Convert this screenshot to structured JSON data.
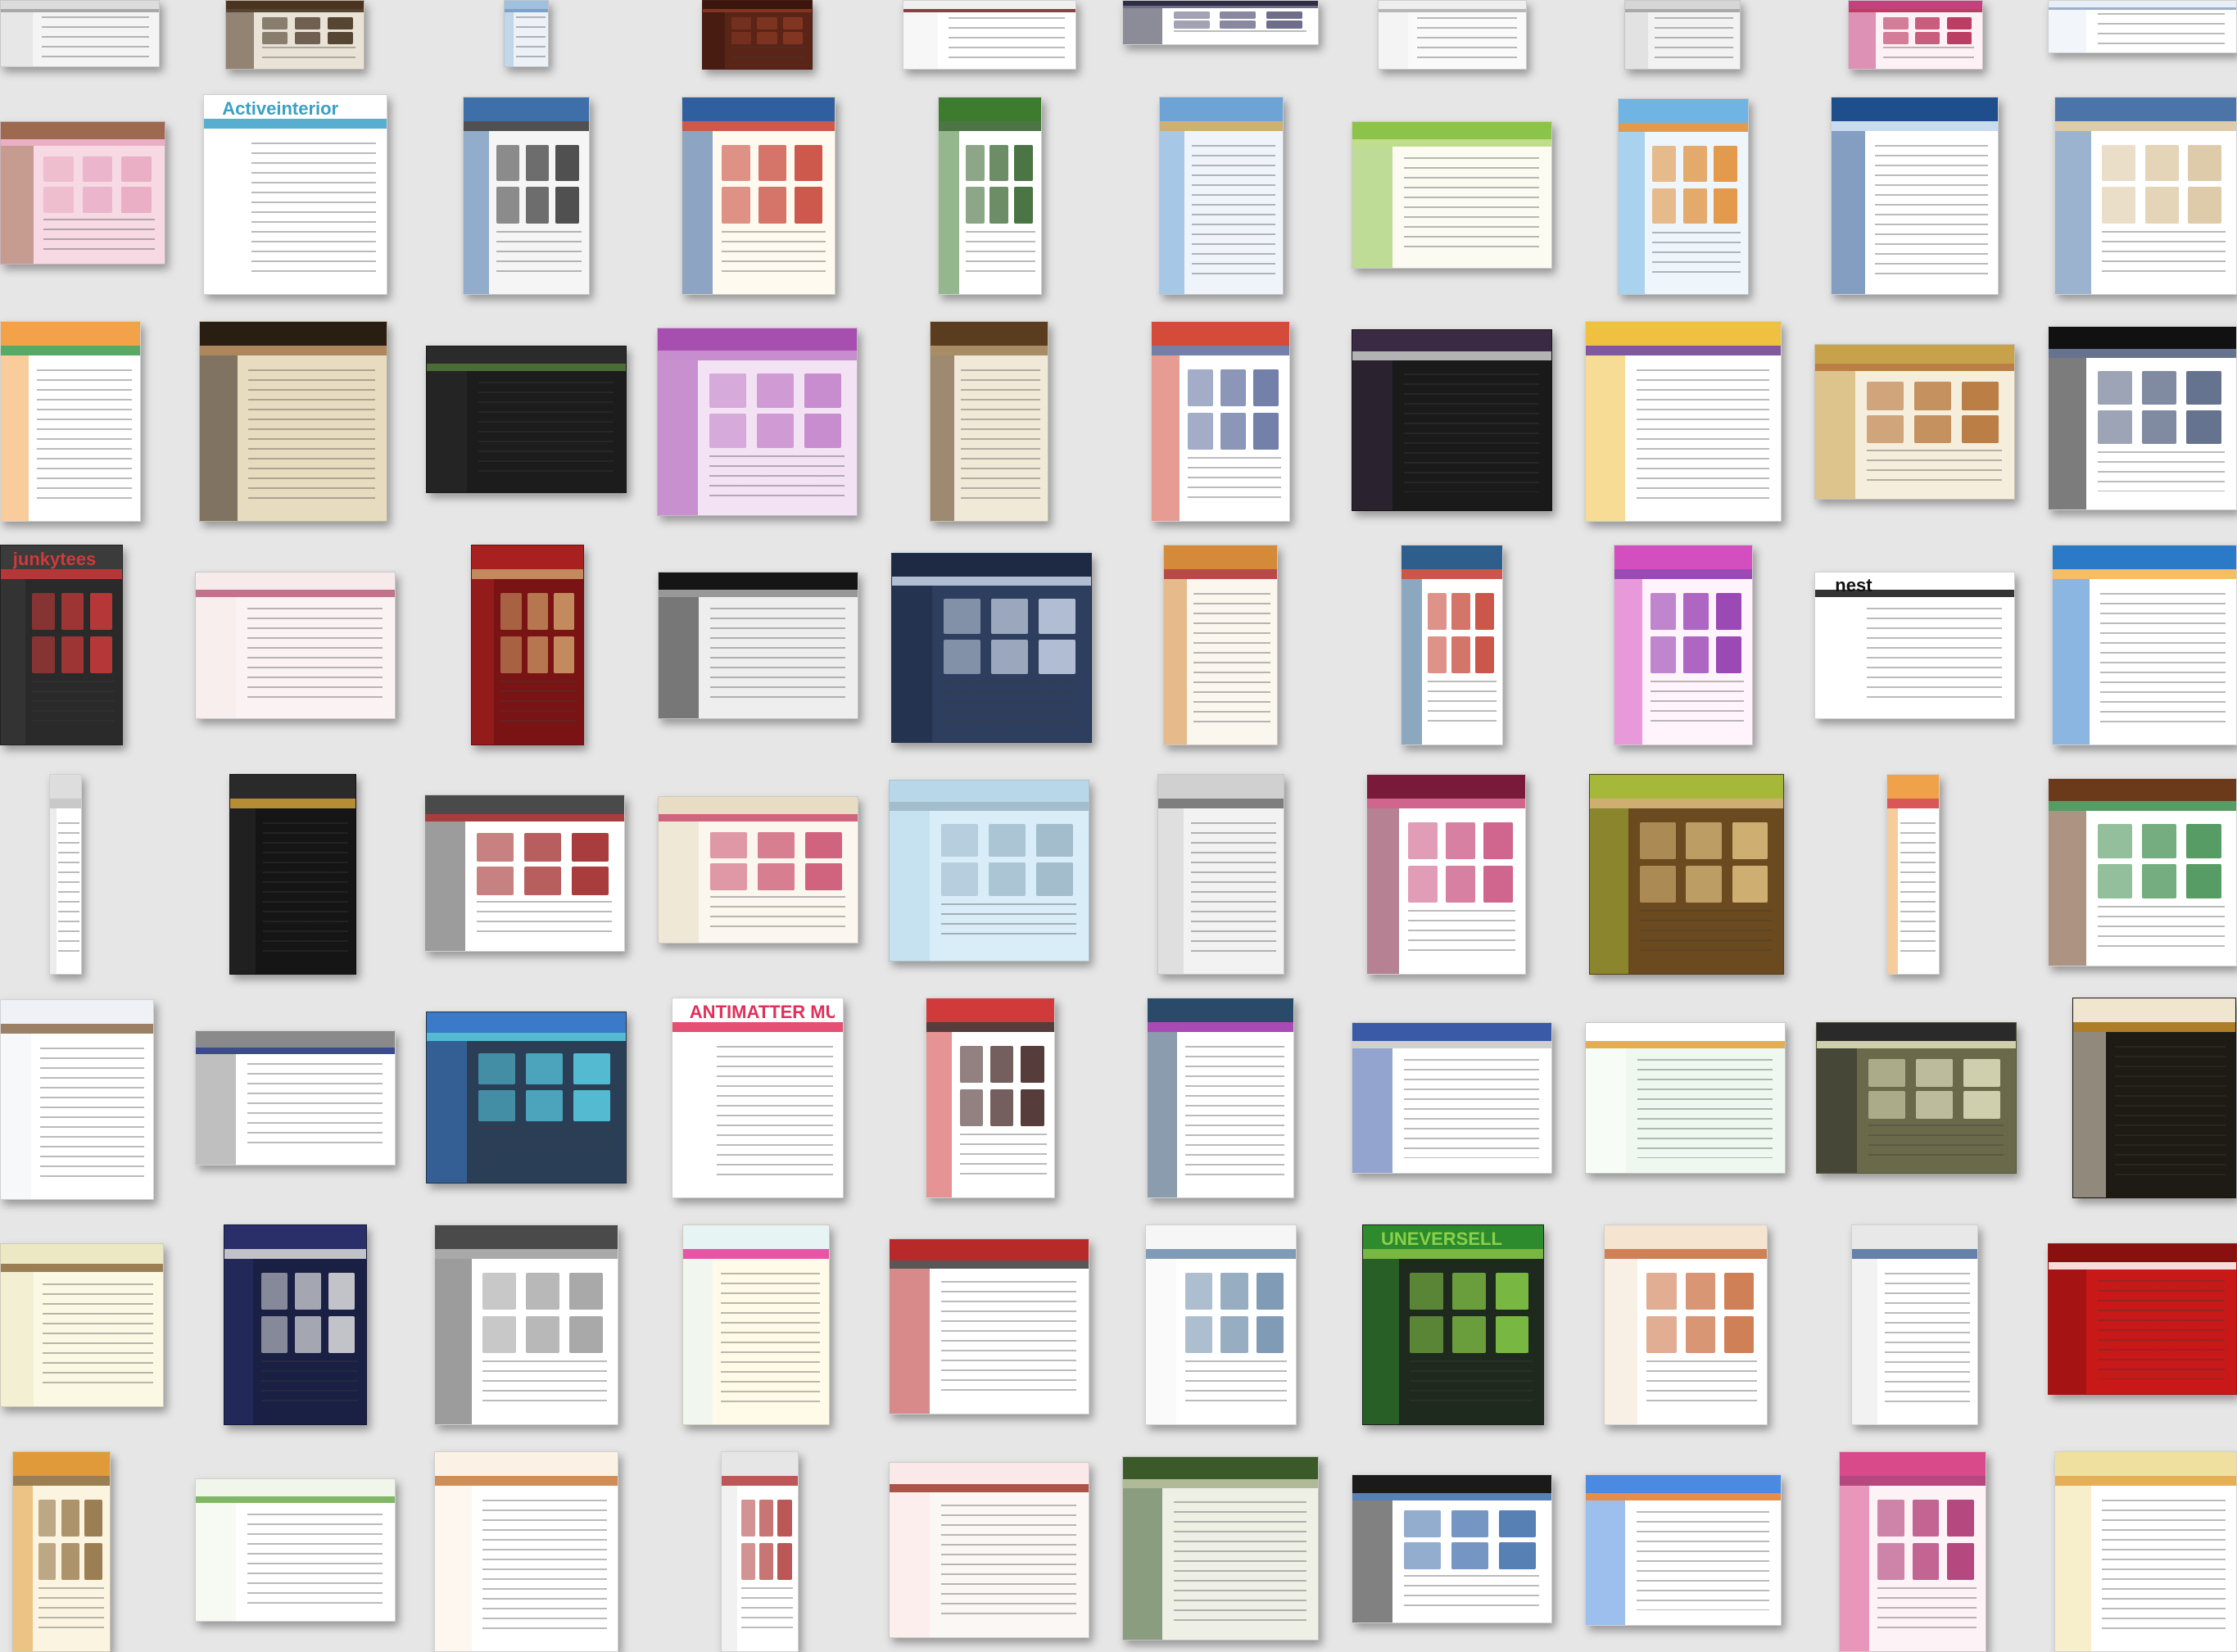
{
  "thumbnails": [
    {
      "label": "",
      "bg": "#f4f4f4",
      "header": "#dcdcdc",
      "accent": "#9a9a9a",
      "layout": "text"
    },
    {
      "label": "",
      "bg": "#e9e2d6",
      "header": "#4a3420",
      "accent": "#3b2a18",
      "layout": "grid"
    },
    {
      "label": "",
      "bg": "#ecf1f7",
      "header": "#9fc0de",
      "accent": "#6b93bd",
      "layout": "text"
    },
    {
      "label": "",
      "bg": "#5a2417",
      "header": "#3a160d",
      "accent": "#8a3a24",
      "layout": "grid"
    },
    {
      "label": "",
      "bg": "#ffffff",
      "header": "#f0f0f0",
      "accent": "#7a1f1f",
      "layout": "text"
    },
    {
      "label": "",
      "bg": "#ffffff",
      "header": "#2d2d44",
      "accent": "#555577",
      "layout": "grid"
    },
    {
      "label": "",
      "bg": "#fafafa",
      "header": "#eeeeee",
      "accent": "#aaaaaa",
      "layout": "text"
    },
    {
      "label": "",
      "bg": "#f2f2f2",
      "header": "#d6d6d6",
      "accent": "#9c9c9c",
      "layout": "text"
    },
    {
      "label": "",
      "bg": "#fdf1f5",
      "header": "#c2427e",
      "accent": "#b11e4a",
      "layout": "grid"
    },
    {
      "label": "",
      "bg": "#ffffff",
      "header": "#e8eef6",
      "accent": "#8aa2c2",
      "layout": "text"
    },
    {
      "label": "",
      "bg": "#f6d9e3",
      "header": "#9e6a4f",
      "accent": "#e7a7c0",
      "layout": "grid"
    },
    {
      "label": "Activeinterior",
      "bg": "#ffffff",
      "header": "#ffffff",
      "accent": "#3aa0c6",
      "layout": "text"
    },
    {
      "label": "",
      "bg": "#f5f5f5",
      "header": "#3f6fa8",
      "accent": "#333333",
      "layout": "grid"
    },
    {
      "label": "",
      "bg": "#fffaf0",
      "header": "#2f5f9e",
      "accent": "#c33c2f",
      "layout": "grid"
    },
    {
      "label": "",
      "bg": "#ffffff",
      "header": "#3d7c2f",
      "accent": "#2d5d24",
      "layout": "grid"
    },
    {
      "label": "",
      "bg": "#eef4fa",
      "header": "#6ea3d6",
      "accent": "#c7a35a",
      "layout": "text"
    },
    {
      "label": "",
      "bg": "#fbfbf2",
      "header": "#8cc34a",
      "accent": "#b5d77a",
      "layout": "text"
    },
    {
      "label": "",
      "bg": "#eef6fc",
      "header": "#6fb4e2",
      "accent": "#e08a2e",
      "layout": "grid"
    },
    {
      "label": "",
      "bg": "#ffffff",
      "header": "#1e4f8c",
      "accent": "#c0d6ec",
      "layout": "text"
    },
    {
      "label": "",
      "bg": "#ffffff",
      "header": "#4b74a8",
      "accent": "#d8c29a",
      "layout": "grid"
    },
    {
      "label": "",
      "bg": "#ffffff",
      "header": "#f4a24a",
      "accent": "#3a9a4a",
      "layout": "text"
    },
    {
      "label": "",
      "bg": "#e8dcc0",
      "header": "#2a1d12",
      "accent": "#a2774a",
      "layout": "text"
    },
    {
      "label": "",
      "bg": "#1c1c1c",
      "header": "#2b2b2b",
      "accent": "#557a3a",
      "layout": "text"
    },
    {
      "label": "",
      "bg": "#f3e1f4",
      "header": "#a64fb1",
      "accent": "#c07ec8",
      "layout": "grid"
    },
    {
      "label": "",
      "bg": "#f1e9d8",
      "header": "#5a3d1e",
      "accent": "#9a7b52",
      "layout": "text"
    },
    {
      "label": "",
      "bg": "#ffffff",
      "header": "#d44b3a",
      "accent": "#5a6a9a",
      "layout": "grid"
    },
    {
      "label": "",
      "bg": "#1a1a1a",
      "header": "#3a2a44",
      "accent": "#cfcfcf",
      "layout": "text"
    },
    {
      "label": "",
      "bg": "#ffffff",
      "header": "#f0c040",
      "accent": "#6a3b8c",
      "layout": "text"
    },
    {
      "label": "",
      "bg": "#f6eedd",
      "header": "#c8a24a",
      "accent": "#b06a2a",
      "layout": "grid"
    },
    {
      "label": "",
      "bg": "#ffffff",
      "header": "#111111",
      "accent": "#4a5a7a",
      "layout": "grid"
    },
    {
      "label": "junkytees",
      "bg": "#2a2a2a",
      "header": "#3b3b3b",
      "accent": "#cf3a3a",
      "layout": "grid"
    },
    {
      "label": "",
      "bg": "#fbf3f3",
      "header": "#f6eaea",
      "accent": "#b65a7a",
      "layout": "text"
    },
    {
      "label": "",
      "bg": "#7a1414",
      "header": "#a82020",
      "accent": "#d0a06a",
      "layout": "grid"
    },
    {
      "label": "",
      "bg": "#eeeeee",
      "header": "#151515",
      "accent": "#888888",
      "layout": "text"
    },
    {
      "label": "",
      "bg": "#2d3e5e",
      "header": "#1e2a44",
      "accent": "#c9d4e6",
      "layout": "grid"
    },
    {
      "label": "",
      "bg": "#fbf6ee",
      "header": "#d58a3a",
      "accent": "#aa2a2a",
      "layout": "text"
    },
    {
      "label": "",
      "bg": "#ffffff",
      "header": "#2e5f8c",
      "accent": "#c23a2a",
      "layout": "grid"
    },
    {
      "label": "",
      "bg": "#fff4fb",
      "header": "#d34fbf",
      "accent": "#8a2aa8",
      "layout": "grid"
    },
    {
      "label": "nest",
      "bg": "#ffffff",
      "header": "#ffffff",
      "accent": "#111111",
      "layout": "text"
    },
    {
      "label": "",
      "bg": "#ffffff",
      "header": "#2a7ac8",
      "accent": "#f3b24a",
      "layout": "text"
    },
    {
      "label": "",
      "bg": "#ffffff",
      "header": "#dddddd",
      "accent": "#c0c0c0",
      "layout": "text"
    },
    {
      "label": "",
      "bg": "#151515",
      "header": "#2a2a2a",
      "accent": "#d2a23a",
      "layout": "text"
    },
    {
      "label": "",
      "bg": "#ffffff",
      "header": "#4a4a4a",
      "accent": "#9a1a1a",
      "layout": "grid"
    },
    {
      "label": "",
      "bg": "#fbf7ee",
      "header": "#e8dcc4",
      "accent": "#c84a6a",
      "layout": "grid"
    },
    {
      "label": "",
      "bg": "#d8edf8",
      "header": "#b8d8ea",
      "accent": "#9ab4c6",
      "layout": "grid"
    },
    {
      "label": "",
      "bg": "#f2f2f2",
      "header": "#d0d0d0",
      "accent": "#6a6a6a",
      "layout": "text"
    },
    {
      "label": "",
      "bg": "#ffffff",
      "header": "#7a1a3a",
      "accent": "#c84a7a",
      "layout": "grid"
    },
    {
      "label": "",
      "bg": "#6a4a1e",
      "header": "#a6b83a",
      "accent": "#e0c080",
      "layout": "grid"
    },
    {
      "label": "",
      "bg": "#ffffff",
      "header": "#f0a24a",
      "accent": "#d23a3a",
      "layout": "text"
    },
    {
      "label": "",
      "bg": "#ffffff",
      "header": "#6a3a1a",
      "accent": "#3a8a4a",
      "layout": "grid"
    },
    {
      "label": "",
      "bg": "#ffffff",
      "header": "#eef2f6",
      "accent": "#8a6a4a",
      "layout": "text"
    },
    {
      "label": "",
      "bg": "#ffffff",
      "header": "#8a8a8a",
      "accent": "#1a2a7a",
      "layout": "text"
    },
    {
      "label": "",
      "bg": "#2a3e56",
      "header": "#3a7ac8",
      "accent": "#5ad0e8",
      "layout": "grid"
    },
    {
      "label": "ANTIMATTER MULTIVERSE",
      "bg": "#ffffff",
      "header": "#ffffff",
      "accent": "#e0305a",
      "layout": "text"
    },
    {
      "label": "",
      "bg": "#ffffff",
      "header": "#d03a3a",
      "accent": "#3a1a1a",
      "layout": "grid"
    },
    {
      "label": "",
      "bg": "#ffffff",
      "header": "#2a4a6a",
      "accent": "#9a2aa8",
      "layout": "text"
    },
    {
      "label": "",
      "bg": "#ffffff",
      "header": "#3a5aa8",
      "accent": "#c8c8c8",
      "layout": "text"
    },
    {
      "label": "",
      "bg": "#eef8ee",
      "header": "#ffffff",
      "accent": "#e0a03a",
      "layout": "text"
    },
    {
      "label": "",
      "bg": "#6a6a4a",
      "header": "#2a2a2a",
      "accent": "#e0e0c0",
      "layout": "grid"
    },
    {
      "label": "",
      "bg": "#1e1a14",
      "header": "#f0e6d0",
      "accent": "#c8902a",
      "layout": "text"
    },
    {
      "label": "",
      "bg": "#fbf8e4",
      "header": "#ece8c4",
      "accent": "#8a6a3a",
      "layout": "text"
    },
    {
      "label": "",
      "bg": "#1a1f44",
      "header": "#2a2f6a",
      "accent": "#e0e0e0",
      "layout": "grid"
    },
    {
      "label": "",
      "bg": "#ffffff",
      "header": "#4a4a4a",
      "accent": "#9a9a9a",
      "layout": "grid"
    },
    {
      "label": "",
      "bg": "#fffbe8",
      "header": "#e6f4f4",
      "accent": "#e03a9a",
      "layout": "text"
    },
    {
      "label": "",
      "bg": "#ffffff",
      "header": "#b82a2a",
      "accent": "#3a3a3a",
      "layout": "text"
    },
    {
      "label": "",
      "bg": "#ffffff",
      "header": "#f6f6f6",
      "accent": "#6a8aa8",
      "layout": "grid"
    },
    {
      "label": "UNEVERSELL",
      "bg": "#1f2a1f",
      "header": "#2d8a2d",
      "accent": "#8ad04a",
      "layout": "grid"
    },
    {
      "label": "",
      "bg": "#ffffff",
      "header": "#f4e4d0",
      "accent": "#c86a3a",
      "layout": "grid"
    },
    {
      "label": "",
      "bg": "#ffffff",
      "header": "#e8e8e8",
      "accent": "#4a6a9a",
      "layout": "text"
    },
    {
      "label": "",
      "bg": "#c81818",
      "header": "#8a1010",
      "accent": "#ffffff",
      "layout": "text"
    },
    {
      "label": "",
      "bg": "#fbf4e0",
      "header": "#e09a3a",
      "accent": "#8a6a3a",
      "layout": "grid"
    },
    {
      "label": "",
      "bg": "#ffffff",
      "header": "#f0f6ea",
      "accent": "#6aaa4a",
      "layout": "text"
    },
    {
      "label": "",
      "bg": "#ffffff",
      "header": "#fbf1e4",
      "accent": "#c87a3a",
      "layout": "text"
    },
    {
      "label": "",
      "bg": "#ffffff",
      "header": "#e6e6e6",
      "accent": "#b03a3a",
      "layout": "grid"
    },
    {
      "label": "",
      "bg": "#fbf7f4",
      "header": "#fbe8e8",
      "accent": "#9a3a2a",
      "layout": "text"
    },
    {
      "label": "",
      "bg": "#eef0e6",
      "header": "#3a5a2a",
      "accent": "#a6b08a",
      "layout": "text"
    },
    {
      "label": "",
      "bg": "#ffffff",
      "header": "#1a1a1a",
      "accent": "#3a6aa8",
      "layout": "grid"
    },
    {
      "label": "",
      "bg": "#ffffff",
      "header": "#4a8ae0",
      "accent": "#e07a2a",
      "layout": "text"
    },
    {
      "label": "",
      "bg": "#fdf2f6",
      "header": "#d84a8a",
      "accent": "#a82a6a",
      "layout": "grid"
    },
    {
      "label": "",
      "bg": "#ffffff",
      "header": "#f0e0a0",
      "accent": "#e0a03a",
      "layout": "text"
    }
  ]
}
